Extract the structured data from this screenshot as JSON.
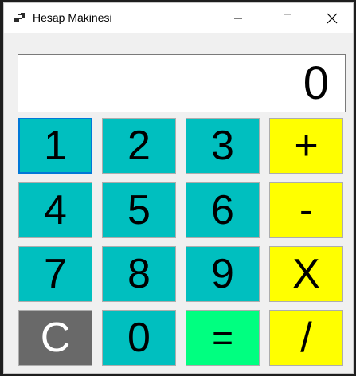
{
  "window": {
    "title": "Hesap Makinesi"
  },
  "display": {
    "value": "0"
  },
  "keys": {
    "k1": "1",
    "k2": "2",
    "k3": "3",
    "plus": "+",
    "k4": "4",
    "k5": "5",
    "k6": "6",
    "minus": "-",
    "k7": "7",
    "k8": "8",
    "k9": "9",
    "multiply": "X",
    "clear": "C",
    "k0": "0",
    "equals": "=",
    "divide": "/"
  },
  "colors": {
    "digit_bg": "#00bfbf",
    "operator_bg": "#ffff00",
    "clear_bg": "#696969",
    "equals_bg": "#00ff80",
    "focus_border": "#0078d7"
  }
}
